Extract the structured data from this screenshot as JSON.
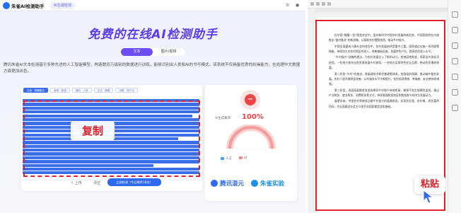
{
  "header": {
    "logo_text": "朱雀AI检测助手",
    "nav_tab": "AI生成检测",
    "right_icons": [
      "settings-icon",
      "user-icon"
    ]
  },
  "hero": {
    "title": "免费的在线AI检测助手",
    "modes": [
      {
        "label": "文本",
        "active": true
      },
      {
        "label": "图片/视频",
        "active": false
      }
    ],
    "intro": "腾讯朱雀AI文本检测基于多种先进的人工智能模型，构造数百万级别的数据进行训练，能够识别出人类和AI的书写模式。该系统不仅具备优秀的抗噪能力，在处理中文数据方面更加出色。"
  },
  "editor": {
    "chips": [
      "文言 · 短篇散文",
      "新闻 · 报道",
      "通讯 · 人物",
      "论文 · 摘要",
      "诗歌 · 现代诗"
    ],
    "overlay_label": "复制",
    "footer": {
      "upload_label": "上传",
      "clear_label": "清空",
      "detect_label": "立即检测（今日剩余18次）"
    }
  },
  "result": {
    "score_label": "AI生成概率",
    "score_value": "100%",
    "legend": [
      {
        "label": "人工",
        "color": "#4aa3ff"
      },
      {
        "label": "AI",
        "color": "#f78a8a"
      }
    ],
    "brands": [
      {
        "label": "腾讯混元",
        "color": "#2f6af4"
      },
      {
        "label": "朱雀实验",
        "color": "#1c8fe8"
      }
    ]
  },
  "document": {
    "paste_label": "粘贴",
    "paragraphs": [
      "在中国“睡醒一觉”脱贫攻坚中，面对新时代中国农村发展的新形势，中国国务院在内部推出“整村推进”的新战略，以帮助农村摆脱贫困，推动乡村振兴。",
      "中国全面建成小康社会的进程中，农村发展始终是重中之重。国家通过实施一系列政策措施，持续加大对农村地区的投入，改善基础设施，发展特色产业，提高农民收入水平。",
      "“乡村振兴”战略的提出，为农村发展注入了新的动力。各地因地制宜，探索出许多成功经验。一些地方依托自然资源发展乡村旅游，一些地方培育特色农业品牌，带动农民增收致富。",
      "第二阶段“乡村”的推进，各级政府不断完善政策体系，加强组织保障，推动城乡融合发展。农村人居环境明显改善，公共服务水平不断提升，农民的获得感、幸福感、安全感持续增强。",
      "第三阶段，巩固拓展脱贫攻坚成果同乡村振兴有效衔接，确保不发生规模性返贫。通过产业帮扶、就业帮扶、消费帮扶等方式，持续增强脱贫地区和脱贫群众的内生发展动力。",
      "展望未来，中国农村将继续沿着乡村振兴的道路前进，实现农业强、农村美、农民富的目标，为全面建设社会主义现代化国家奠定坚实基础。"
    ]
  }
}
